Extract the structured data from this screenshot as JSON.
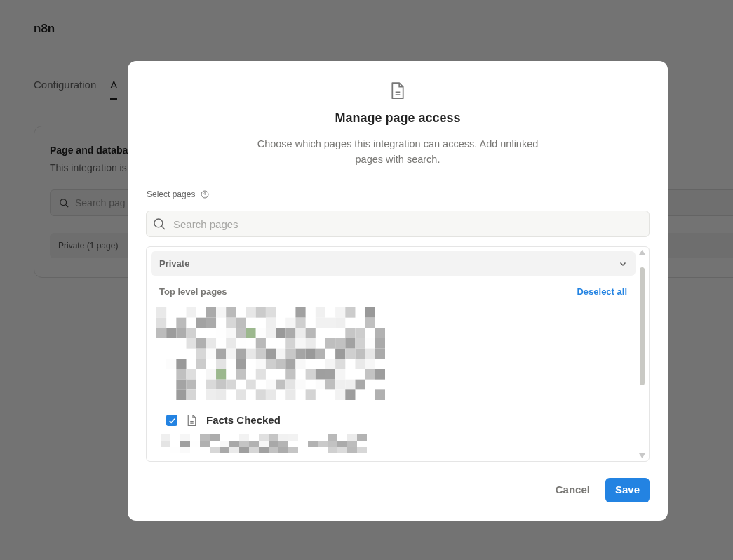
{
  "app": {
    "title": "n8n"
  },
  "tabs": [
    {
      "label": "Configuration",
      "selected": false
    },
    {
      "label": "A",
      "selected": true
    }
  ],
  "card": {
    "title": "Page and databa",
    "subtitle": "This integration is",
    "search_placeholder": "Search pag",
    "section": "Private (1 page)"
  },
  "dialog": {
    "title": "Manage page access",
    "description": "Choose which pages this integration can access. Add unlinked pages with search.",
    "field_label": "Select pages",
    "search_placeholder": "Search pages",
    "section": {
      "label": "Private",
      "expanded": true,
      "group_label": "Top level pages",
      "action": "Deselect all",
      "pages": [
        {
          "title": "Facts Checked",
          "checked": true
        }
      ]
    },
    "buttons": [
      {
        "label": "Cancel",
        "kind": "secondary"
      },
      {
        "label": "Save",
        "kind": "primary"
      }
    ]
  }
}
